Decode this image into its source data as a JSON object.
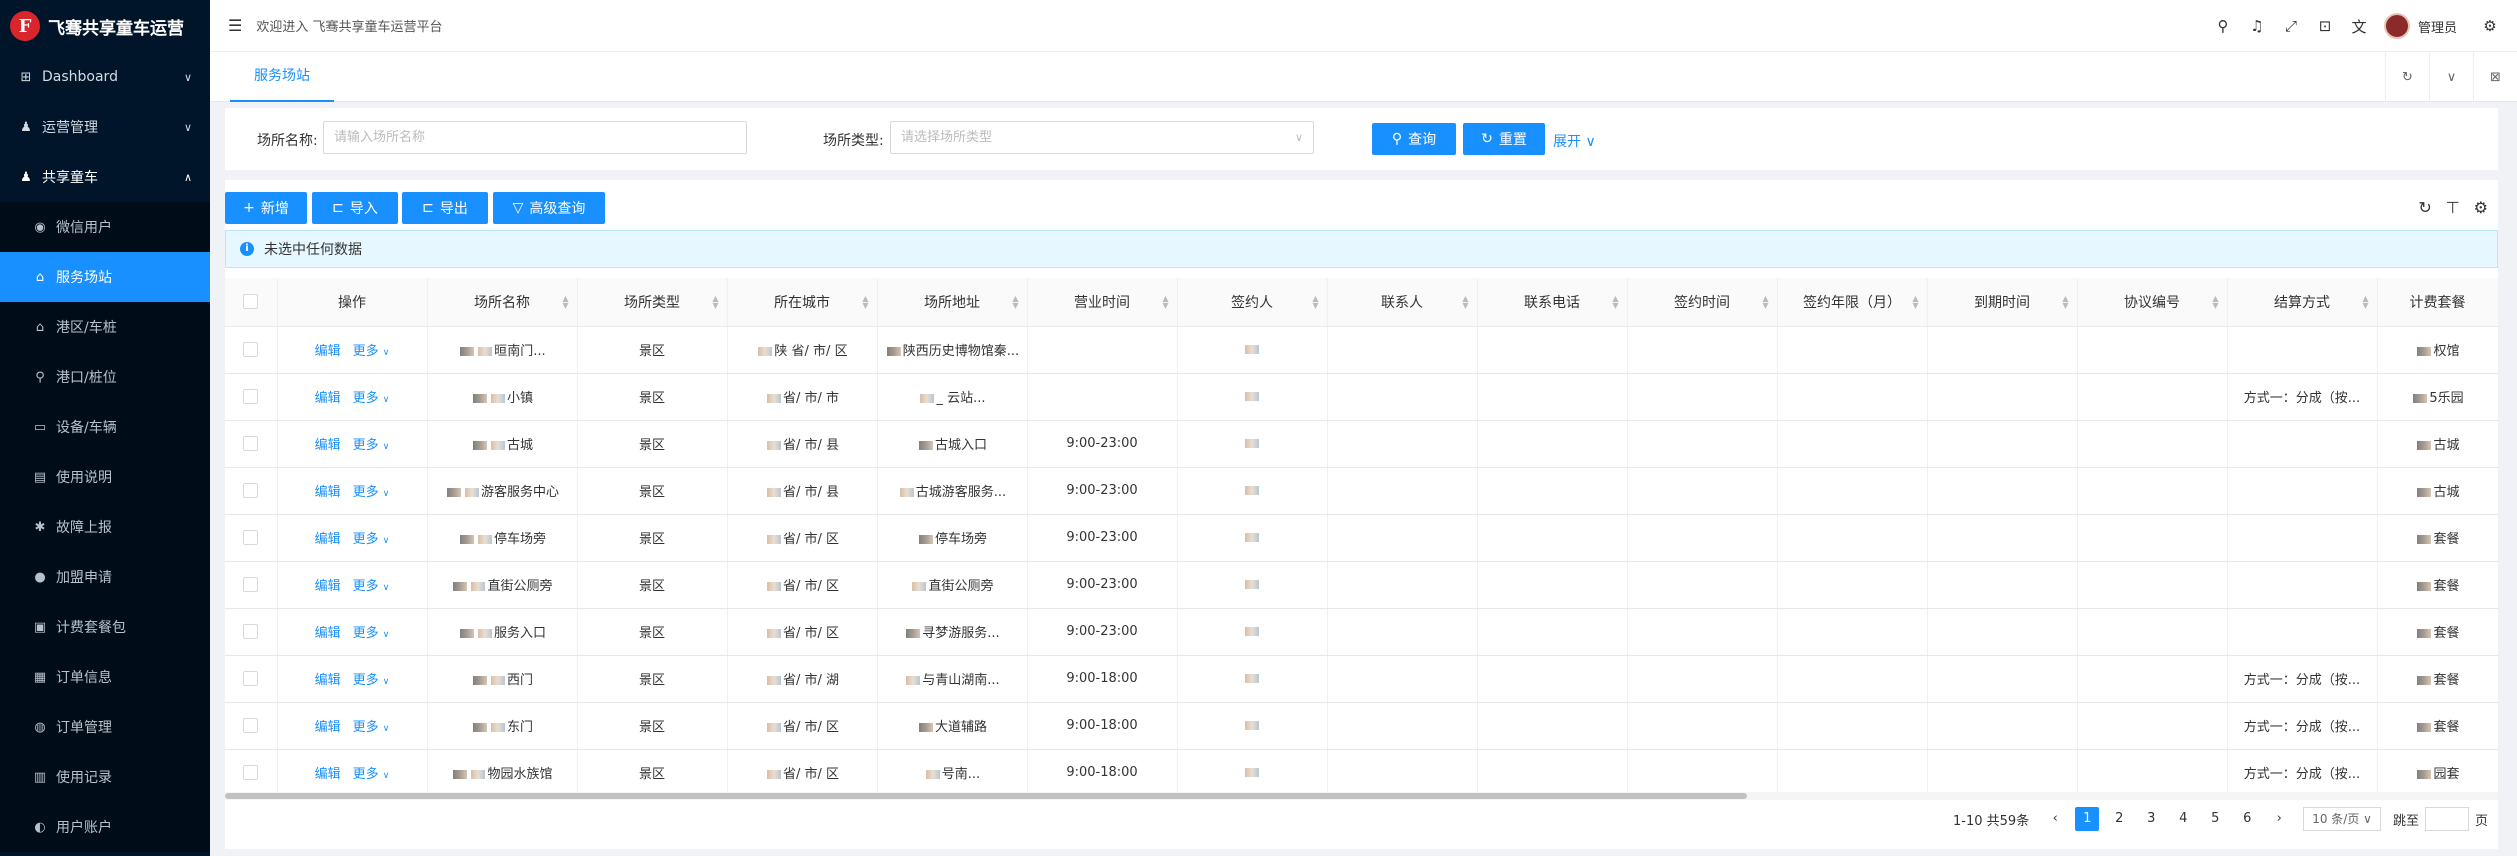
{
  "app": {
    "logo_text": "飞骞共享童车运营",
    "welcome": "欢迎进入 飞骞共享童车运营平台",
    "user": "管理员"
  },
  "sidebar": {
    "items": [
      {
        "label": "Dashboard",
        "icon": "grid-icon"
      },
      {
        "label": "运营管理",
        "icon": "user-icon"
      },
      {
        "label": "共享童车",
        "icon": "user-icon"
      }
    ],
    "subitems": [
      {
        "label": "微信用户",
        "icon": "wechat-icon"
      },
      {
        "label": "服务场站",
        "icon": "bank-icon"
      },
      {
        "label": "港区/车桩",
        "icon": "home-icon"
      },
      {
        "label": "港口/桩位",
        "icon": "plug-icon"
      },
      {
        "label": "设备/车辆",
        "icon": "car-icon"
      },
      {
        "label": "使用说明",
        "icon": "file-icon"
      },
      {
        "label": "故障上报",
        "icon": "bug-icon"
      },
      {
        "label": "加盟申请",
        "icon": "badge-icon"
      },
      {
        "label": "计费套餐包",
        "icon": "package-icon"
      },
      {
        "label": "订单信息",
        "icon": "order-icon"
      },
      {
        "label": "订单管理",
        "icon": "manage-icon"
      },
      {
        "label": "使用记录",
        "icon": "record-icon"
      },
      {
        "label": "用户账户",
        "icon": "account-icon"
      }
    ]
  },
  "tabs": {
    "active": "服务场站"
  },
  "search": {
    "name_label": "场所名称:",
    "name_placeholder": "请输入场所名称",
    "type_label": "场所类型:",
    "type_placeholder": "请选择场所类型",
    "query": "查询",
    "reset": "重置",
    "expand": "展开"
  },
  "toolbar": {
    "add": "新增",
    "import": "导入",
    "export": "导出",
    "advanced": "高级查询"
  },
  "alert": "未选中任何数据",
  "table": {
    "headers": [
      "操作",
      "场所名称",
      "场所类型",
      "所在城市",
      "场所地址",
      "营业时间",
      "签约人",
      "联系人",
      "联系电话",
      "签约时间",
      "签约年限（月）",
      "到期时间",
      "协议编号",
      "结算方式",
      "计费套餐"
    ],
    "edit": "编辑",
    "more": "更多",
    "rows": [
      {
        "name": "晅南门...",
        "type": "景区",
        "city": "陕 省/ 市/ 区",
        "addr": "陕西历史博物馆秦...",
        "hours": "",
        "settle": "",
        "pkg": "权馆"
      },
      {
        "name": "小镇",
        "type": "景区",
        "city": "省/ 市/ 市",
        "addr": "_ 云站...",
        "hours": "",
        "settle": "方式一：分成（按...",
        "pkg": "5乐园"
      },
      {
        "name": "古城",
        "type": "景区",
        "city": "省/ 市/ 县",
        "addr": "古城入口",
        "hours": "9:00-23:00",
        "settle": "",
        "pkg": "古城"
      },
      {
        "name": "游客服务中心",
        "type": "景区",
        "city": "省/ 市/ 县",
        "addr": "古城游客服务...",
        "hours": "9:00-23:00",
        "settle": "",
        "pkg": "古城"
      },
      {
        "name": "停车场旁",
        "type": "景区",
        "city": "省/ 市/ 区",
        "addr": "停车场旁",
        "hours": "9:00-23:00",
        "settle": "",
        "pkg": "套餐"
      },
      {
        "name": "直街公厕旁",
        "type": "景区",
        "city": "省/ 市/ 区",
        "addr": "直街公厕旁",
        "hours": "9:00-23:00",
        "settle": "",
        "pkg": "套餐"
      },
      {
        "name": "服务入口",
        "type": "景区",
        "city": "省/ 市/ 区",
        "addr": "寻梦游服务...",
        "hours": "9:00-23:00",
        "settle": "",
        "pkg": "套餐"
      },
      {
        "name": "西门",
        "type": "景区",
        "city": "省/ 市/ 湖",
        "addr": "与青山湖南...",
        "hours": "9:00-18:00",
        "settle": "方式一：分成（按...",
        "pkg": "套餐"
      },
      {
        "name": "东门",
        "type": "景区",
        "city": "省/ 市/ 区",
        "addr": "大道辅路",
        "hours": "9:00-18:00",
        "settle": "方式一：分成（按...",
        "pkg": "套餐"
      },
      {
        "name": "物园水族馆",
        "type": "景区",
        "city": "省/ 市/ 区",
        "addr": "号南...",
        "hours": "9:00-18:00",
        "settle": "方式一：分成（按...",
        "pkg": "园套"
      }
    ]
  },
  "pagination": {
    "summary": "1-10 共59条",
    "pages": [
      "1",
      "2",
      "3",
      "4",
      "5",
      "6"
    ],
    "current": "1",
    "size": "10 条/页",
    "jump": "跳至",
    "page_unit": "页"
  }
}
